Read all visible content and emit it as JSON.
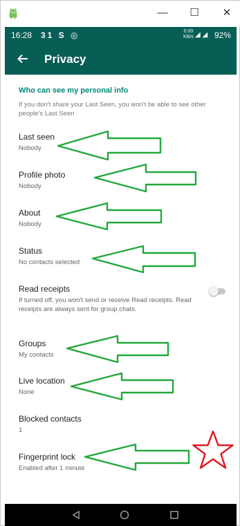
{
  "window": {
    "controls": {
      "minimize": "—",
      "maximize": "☐",
      "close": "✕"
    }
  },
  "status_bar": {
    "time": "16:28",
    "indicators": "31 S ◎",
    "speed_top": "0.00",
    "speed_bottom": "KB/s",
    "signal": "◢ ◢",
    "battery": "92%"
  },
  "toolbar": {
    "back_icon": "arrow-back-icon",
    "title": "Privacy"
  },
  "section": {
    "header": "Who can see my personal info",
    "description": "If you don't share your Last Seen, you won't be able to see other people's Last Seen"
  },
  "items": [
    {
      "label": "Last seen",
      "value": "Nobody"
    },
    {
      "label": "Profile photo",
      "value": "Nobody"
    },
    {
      "label": "About",
      "value": "Nobody"
    },
    {
      "label": "Status",
      "value": "No contacts selected"
    },
    {
      "label": "Read receipts",
      "value": "If turned off, you won't send or receive Read receipts. Read receipts are always sent for group chats."
    },
    {
      "label": "Groups",
      "value": "My contacts"
    },
    {
      "label": "Live location",
      "value": "None"
    },
    {
      "label": "Blocked contacts",
      "value": "1"
    },
    {
      "label": "Fingerprint lock",
      "value": "Enabled after 1 minute"
    }
  ],
  "read_receipts_enabled": false,
  "navbar": {
    "back": "back-triangle-icon",
    "home": "home-circle-icon",
    "recents": "recents-square-icon"
  },
  "colors": {
    "primary": "#075e54",
    "accent": "#00897b",
    "annotation_arrow": "#22a83a",
    "annotation_star": "#e0141e"
  }
}
